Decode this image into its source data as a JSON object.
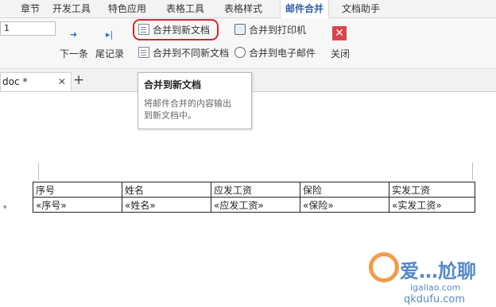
{
  "menu_tabs": [
    "章节",
    "开发工具",
    "特色应用",
    "表格工具",
    "表格样式",
    "邮件合并",
    "文档助手"
  ],
  "active_tab": "邮件合并",
  "ribbon": {
    "record_field_value": "1",
    "next_arrow": "➜",
    "last_arrow": "▸|",
    "next_record": "下一条",
    "last_record": "尾记录",
    "merge_new_doc": "合并到新文档",
    "merge_diff_docs": "合并到不同新文档",
    "merge_printer": "合并到打印机",
    "merge_email": "合并到电子邮件",
    "close": "关闭",
    "close_glyph": "✕"
  },
  "doc_tab": {
    "name": "doc *",
    "close_glyph": "✕",
    "add_glyph": "+"
  },
  "tooltip": {
    "title": "合并到新文档",
    "body": [
      "将邮件合并的内容输出",
      "到新文档中。"
    ]
  },
  "table": {
    "headers": [
      "序号",
      "姓名",
      "应发工资",
      "保险",
      "实发工资"
    ],
    "fields": [
      "«序号»",
      "«姓名»",
      "«应发工资»",
      "«保险»",
      "«实发工资»"
    ]
  },
  "row_mark": "▾",
  "watermark": {
    "text": "爱…尬聊",
    "url1": "igaliao.com",
    "url2": "qkdufu.com"
  },
  "colors": {
    "accent": "#2f5ea8",
    "highlight": "#d1272c",
    "close": "#d9464a",
    "watermark": "#2c6db8"
  }
}
